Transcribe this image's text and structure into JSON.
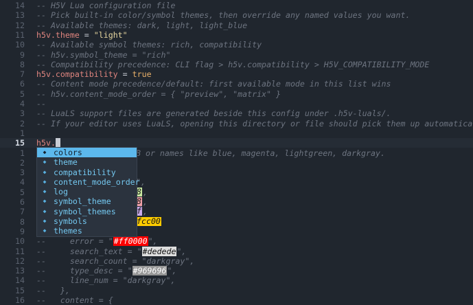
{
  "lines": [
    {
      "num": "14",
      "text": "-- H5V Lua configuration file"
    },
    {
      "num": "13",
      "text": "-- Pick built-in color/symbol themes, then override any named values you want."
    },
    {
      "num": "12",
      "text": "-- Available themes: dark, light, light_blue"
    },
    {
      "num": "11",
      "id": "h5v.theme",
      "op": " = ",
      "value": "\"light\""
    },
    {
      "num": "10",
      "text": "-- Available symbol themes: rich, compatibility"
    },
    {
      "num": "9",
      "text": "-- h5v.symbol_theme = \"rich\""
    },
    {
      "num": "8",
      "text": "-- Compatibility precedence: CLI flag > h5v.compatibility > H5V_COMPATIBILITY_MODE"
    },
    {
      "num": "7",
      "id": "h5v.compatibility",
      "op": " = ",
      "value": "true"
    },
    {
      "num": "6",
      "text": "-- Content mode precedence/default: first available mode in this list wins"
    },
    {
      "num": "5",
      "text": "-- h5v.content_mode_order = { \"preview\", \"matrix\" }"
    },
    {
      "num": "4",
      "text": "--"
    },
    {
      "num": "3",
      "text": "-- LuaLS support files are generated beside this config under .h5v-luals/."
    },
    {
      "num": "2",
      "text": "-- If your editor uses LuaLS, opening this directory or file should pick them up automatically."
    },
    {
      "num": "1",
      "text": ""
    },
    {
      "num": "15",
      "id": "h5v."
    },
    {
      "num": "1",
      "text": "B or names like blue, magenta, lightgreen, darkgray."
    },
    {
      "num": "2",
      "text": ""
    },
    {
      "num": "3",
      "text": ""
    },
    {
      "num": "4",
      "text": "\","
    },
    {
      "num": "5",
      "text": ","
    },
    {
      "num": "6",
      "text": ","
    },
    {
      "num": "7",
      "text": ","
    },
    {
      "num": "8",
      "text": ""
    },
    {
      "num": "9",
      "text": ""
    },
    {
      "num": "10",
      "pre": "--     error = \"",
      "swatch": "#ff0000",
      "post": "\","
    },
    {
      "num": "11",
      "pre": "--     search_text = \"",
      "swatch": "#dedede",
      "post": "\","
    },
    {
      "num": "12",
      "text": "--     search_count = \"darkgray\","
    },
    {
      "num": "13",
      "pre": "--     type_desc = \"",
      "swatch": "#969696",
      "post": "\","
    },
    {
      "num": "14",
      "text": "--     line_num = \"darkgray\","
    },
    {
      "num": "15",
      "text": "--   },"
    },
    {
      "num": "16",
      "text": "--   content = {"
    }
  ],
  "completion": {
    "kind_icon": "field-icon",
    "items": [
      "colors",
      "theme",
      "compatibility",
      "content_mode_order",
      "log",
      "symbol_theme",
      "symbol_themes",
      "symbols",
      "themes"
    ],
    "selected_index": 0
  },
  "partial_swatches": [
    {
      "row": 19,
      "text": "8",
      "color": "#c8e8a0"
    },
    {
      "row": 20,
      "text": "8",
      "color": "#f0a0a8"
    },
    {
      "row": 21,
      "text": "f",
      "color": "#c8a8e8"
    },
    {
      "row": 22,
      "text": "fcc00",
      "color": "#ffcc00"
    }
  ],
  "colors": {
    "background": "#20262e",
    "comment": "#6d7480",
    "identifier": "#e0857f",
    "string": "#e6d6a0",
    "boolean": "#e8b06a",
    "popup_selected": "#5cb8ec",
    "popup_item": "#74c8f0"
  }
}
